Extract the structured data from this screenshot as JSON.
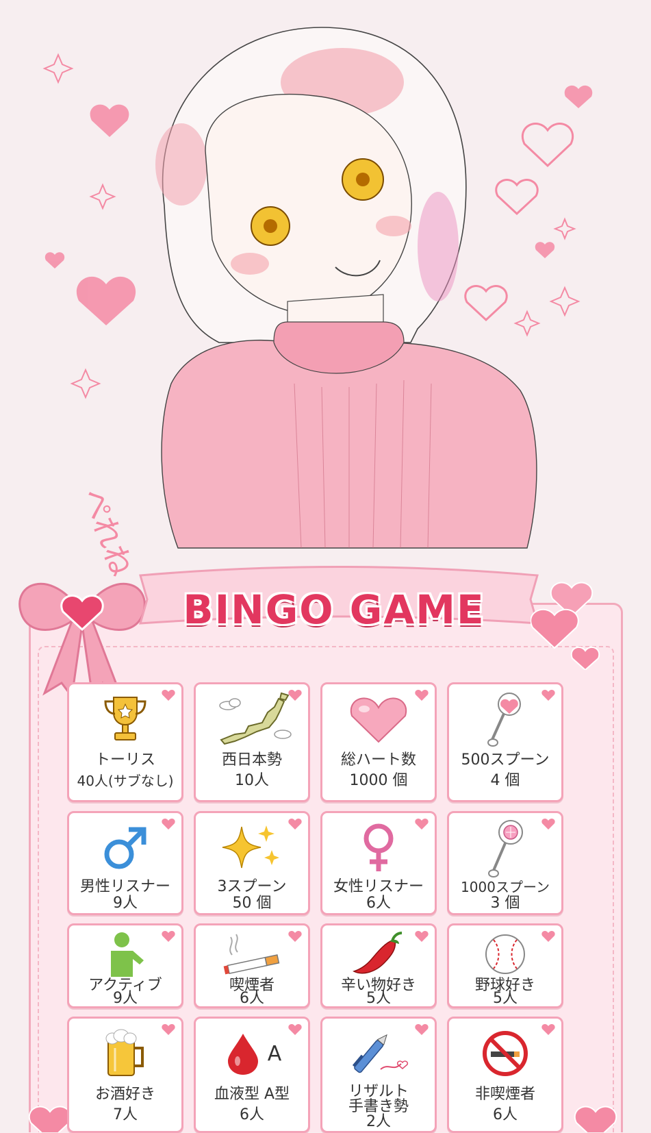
{
  "signature": "ぺれね",
  "banner_title": "BINGO GAME",
  "colors": {
    "accent": "#e2375f",
    "board": "#fde7ed",
    "border": "#f4a3b8",
    "heart": "#f48aa4"
  },
  "cells": [
    {
      "icon": "trophy-icon",
      "line1": "トーリス",
      "line2": "40人(サブなし)"
    },
    {
      "icon": "japan-map-icon",
      "line1": "西日本勢",
      "line2": "10人"
    },
    {
      "icon": "big-heart-icon",
      "line1": "総ハート数",
      "line2": "1000 個"
    },
    {
      "icon": "heart-spoon-icon",
      "line1": "500スプーン",
      "line2": "4 個"
    },
    {
      "icon": "male-symbol-icon",
      "line1": "男性リスナー",
      "line2": "9人"
    },
    {
      "icon": "sparkle-icon",
      "line1": "3スプーン",
      "line2": "50 個"
    },
    {
      "icon": "female-symbol-icon",
      "line1": "女性リスナー",
      "line2": "6人"
    },
    {
      "icon": "gem-spoon-icon",
      "line1": "1000スプーン",
      "line2": "3 個"
    },
    {
      "icon": "active-person-icon",
      "line1": "アクティブ",
      "line2": "9人"
    },
    {
      "icon": "cigarette-icon",
      "line1": "喫煙者",
      "line2": "6人"
    },
    {
      "icon": "chili-pepper-icon",
      "line1": "辛い物好き",
      "line2": "5人"
    },
    {
      "icon": "baseball-icon",
      "line1": "野球好き",
      "line2": "5人"
    },
    {
      "icon": "beer-mug-icon",
      "line1": "お酒好き",
      "line2": "7人"
    },
    {
      "icon": "blood-drop-icon",
      "line1": "血液型 A型",
      "line2": "6人",
      "icon_text": "A"
    },
    {
      "icon": "pen-icon",
      "line1": "リザルト",
      "line2": "手書き勢",
      "line3": "2人"
    },
    {
      "icon": "no-smoking-icon",
      "line1": "非喫煙者",
      "line2": "6人"
    }
  ]
}
